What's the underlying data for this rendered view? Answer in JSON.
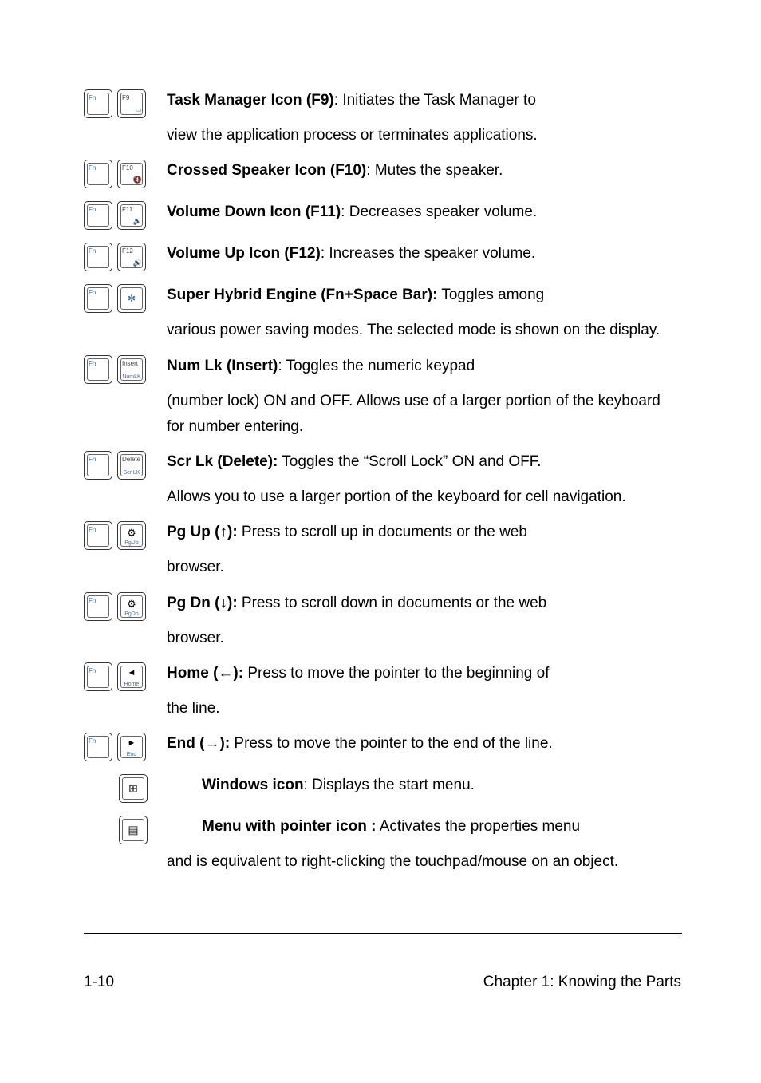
{
  "rows": [
    {
      "leftKeyTop": "Fn",
      "rightKeyTop": "F9",
      "rightKeyBR": "▭",
      "label": "Task Manager Icon (F9)",
      "text": ": Initiates the Task Manager to",
      "continuation": "view the application process or terminates applications."
    },
    {
      "leftKeyTop": "Fn",
      "rightKeyTop": "F10",
      "rightKeyBR": "🔇",
      "label": "Crossed Speaker Icon (F10)",
      "text": ": Mutes the speaker."
    },
    {
      "leftKeyTop": "Fn",
      "rightKeyTop": "F11",
      "rightKeyBR": "🔉",
      "label": "Volume Down Icon (F11)",
      "text": ": Decreases speaker volume."
    },
    {
      "leftKeyTop": "Fn",
      "rightKeyTop": "F12",
      "rightKeyBR": "🔊",
      "label": "Volume Up Icon (F12)",
      "text": ": Increases the speaker volume."
    },
    {
      "leftKeyTop": "Fn",
      "rightKeyCenter": "✼",
      "label": "Super Hybrid Engine (Fn+Space Bar):",
      "text": " Toggles among",
      "continuation": "various power saving modes. The selected mode is shown on the display."
    },
    {
      "leftKeyTop": "Fn",
      "rightKeyTop": "Insert",
      "rightKeyBottom": "NumLK",
      "label": "Num Lk (Insert)",
      "text": ": Toggles the numeric keypad",
      "continuation": "(number lock) ON and OFF. Allows use of a larger portion of the keyboard for number entering."
    },
    {
      "leftKeyTop": "Fn",
      "rightKeyTop": "Delete",
      "rightKeyBottom": "Scr LK",
      "label": "Scr Lk (Delete):",
      "text": " Toggles the “Scroll Lock” ON and OFF.",
      "continuation": "Allows you to use a larger portion of the keyboard for cell navigation."
    },
    {
      "leftKeyTop": "Fn",
      "rightKeyCenterGear": "⚙",
      "rightKeyBottom": "PgUp",
      "label": "Pg Up (↑):",
      "text": " Press to scroll up in documents or the web",
      "continuation": "browser."
    },
    {
      "leftKeyTop": "Fn",
      "rightKeyCenterGear": "⚙",
      "rightKeyBottom": "PgDn",
      "label": "Pg Dn (↓):",
      "text": " Press to scroll down in documents or the web",
      "continuation": "browser."
    },
    {
      "leftKeyTop": "Fn",
      "rightKeyArrow": "◄",
      "rightKeyBottom": "Home",
      "label": "Home (←):",
      "text": " Press to move the pointer to the beginning of",
      "continuation": "the line."
    },
    {
      "leftKeyTop": "Fn",
      "rightKeyArrow": "►",
      "rightKeyBottom": "End",
      "label": "End (→):",
      "text": " Press to move the pointer to the end of the line."
    },
    {
      "singleKey": true,
      "centerIcon": "⊞",
      "label": "Windows icon",
      "text": ": Displays the start menu."
    },
    {
      "singleKey": true,
      "centerIcon": "▤",
      "label": "Menu with pointer icon :",
      "text": " Activates the properties menu",
      "continuation": "and is equivalent to right-clicking the touchpad/mouse on an object."
    }
  ],
  "footer": {
    "left": "1-10",
    "right": "Chapter 1: Knowing the Parts"
  }
}
